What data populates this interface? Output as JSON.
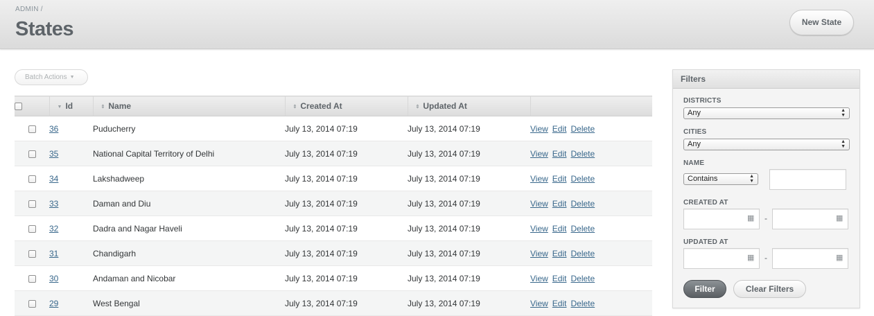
{
  "breadcrumb": {
    "root": "ADMIN",
    "separator": "/"
  },
  "page": {
    "title": "States"
  },
  "actions": {
    "new_label": "New State"
  },
  "batch": {
    "label": "Batch Actions",
    "caret": "▼"
  },
  "table": {
    "headers": {
      "id": "Id",
      "name": "Name",
      "created": "Created At",
      "updated": "Updated At"
    },
    "rows": [
      {
        "id": "36",
        "name": "Puducherry",
        "created": "July 13, 2014 07:19",
        "updated": "July 13, 2014 07:19"
      },
      {
        "id": "35",
        "name": "National Capital Territory of Delhi",
        "created": "July 13, 2014 07:19",
        "updated": "July 13, 2014 07:19"
      },
      {
        "id": "34",
        "name": "Lakshadweep",
        "created": "July 13, 2014 07:19",
        "updated": "July 13, 2014 07:19"
      },
      {
        "id": "33",
        "name": "Daman and Diu",
        "created": "July 13, 2014 07:19",
        "updated": "July 13, 2014 07:19"
      },
      {
        "id": "32",
        "name": "Dadra and Nagar Haveli",
        "created": "July 13, 2014 07:19",
        "updated": "July 13, 2014 07:19"
      },
      {
        "id": "31",
        "name": "Chandigarh",
        "created": "July 13, 2014 07:19",
        "updated": "July 13, 2014 07:19"
      },
      {
        "id": "30",
        "name": "Andaman and Nicobar",
        "created": "July 13, 2014 07:19",
        "updated": "July 13, 2014 07:19"
      },
      {
        "id": "29",
        "name": "West Bengal",
        "created": "July 13, 2014 07:19",
        "updated": "July 13, 2014 07:19"
      }
    ],
    "row_actions": {
      "view": "View",
      "edit": "Edit",
      "delete": "Delete"
    }
  },
  "filters": {
    "title": "Filters",
    "districts": {
      "label": "DISTRICTS",
      "value": "Any"
    },
    "cities": {
      "label": "CITIES",
      "value": "Any"
    },
    "name": {
      "label": "NAME",
      "operator": "Contains",
      "value": ""
    },
    "created_at": {
      "label": "CREATED AT",
      "separator": "-"
    },
    "updated_at": {
      "label": "UPDATED AT",
      "separator": "-"
    },
    "filter_label": "Filter",
    "clear_label": "Clear Filters"
  },
  "icons": {
    "sort": "sort-icon",
    "sort_desc": "sort-desc-icon",
    "calendar": "calendar-icon",
    "select_arrows": "select-arrows-icon"
  }
}
